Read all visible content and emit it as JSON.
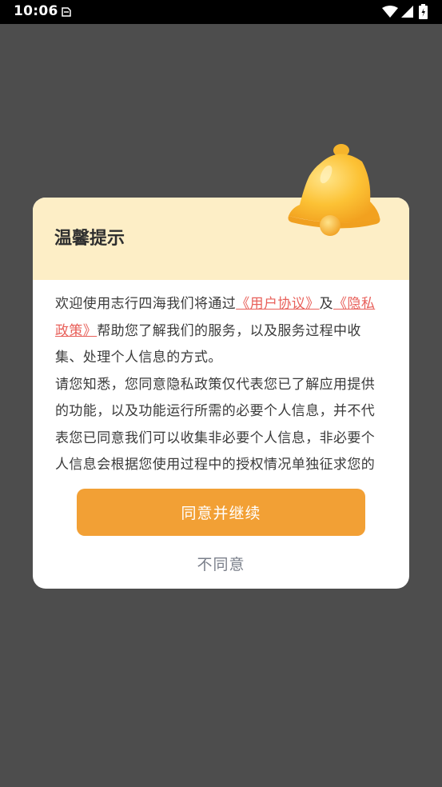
{
  "status_bar": {
    "time": "10:06"
  },
  "dialog": {
    "title": "温馨提示",
    "body": {
      "intro_before": "欢迎使用志行四海我们将通过",
      "user_agreement_link": "《用户协议》",
      "conjunction": "及",
      "privacy_policy_link": "《隐私政策》",
      "intro_after": "帮助您了解我们的服务，以及服务过程中收集、处理个人信息的方式。",
      "paragraph_2": "请您知悉，您同意隐私政策仅代表您已了解应用提供的功能，以及功能运行所需的必要个人信息，并不代表您已同意我们可以收集非必要个人信息，非必要个人信息会根据您使用过程中的授权情况单独征求您的"
    },
    "agree_label": "同意并继续",
    "disagree_label": "不同意"
  },
  "colors": {
    "overlay": "#4d4d4d",
    "header_bg": "#fdeec6",
    "accent": "#f2a035",
    "link": "#e8605a"
  }
}
